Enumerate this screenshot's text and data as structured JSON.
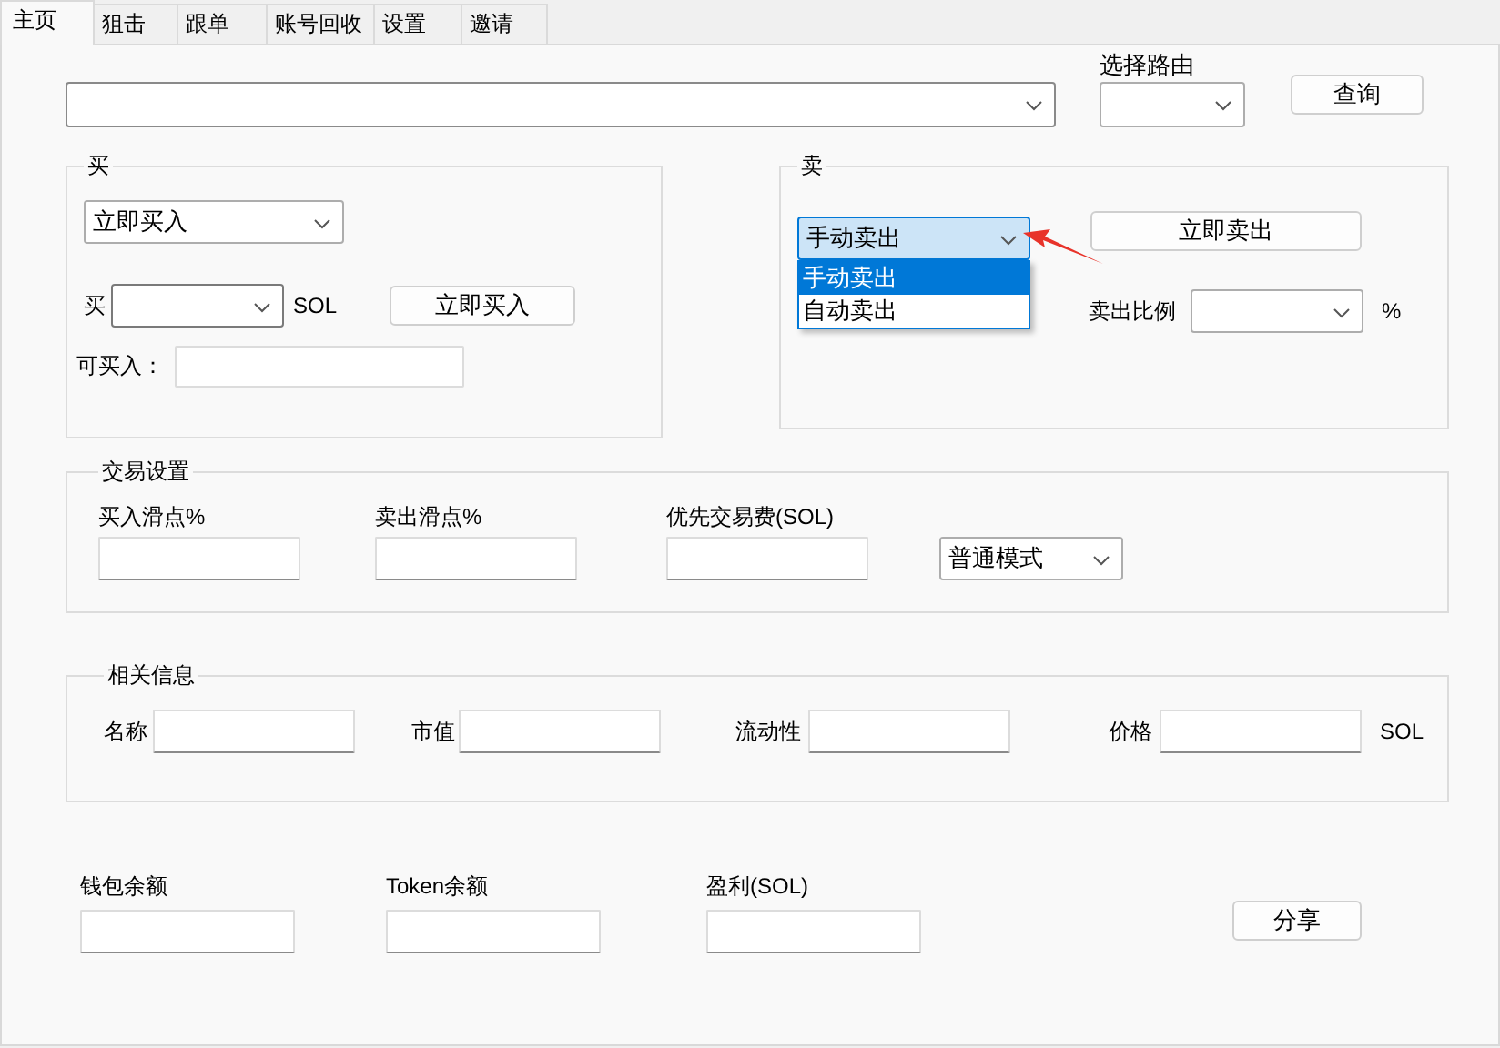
{
  "tabs": [
    {
      "label": "主页",
      "selected": true
    },
    {
      "label": "狙击",
      "selected": false
    },
    {
      "label": "跟单",
      "selected": false
    },
    {
      "label": "账号回收",
      "selected": false
    },
    {
      "label": "设置",
      "selected": false
    },
    {
      "label": "邀请",
      "selected": false
    }
  ],
  "top_bar": {
    "route_label": "选择路由",
    "query_button": "查询"
  },
  "buy": {
    "title": "买",
    "mode": "立即买入",
    "amount_label": "买",
    "unit": "SOL",
    "buy_button": "立即买入",
    "available_label": "可买入："
  },
  "sell": {
    "title": "卖",
    "mode": "手动卖出",
    "expanded": true,
    "options": [
      {
        "label": "手动卖出",
        "selected": true
      },
      {
        "label": "自动卖出",
        "selected": false
      }
    ],
    "sell_button": "立即卖出",
    "ratio_label": "卖出比例",
    "unit": "%"
  },
  "trade_settings": {
    "title": "交易设置",
    "fields": [
      {
        "label": "买入滑点%"
      },
      {
        "label": "卖出滑点%"
      },
      {
        "label": "优先交易费(SOL)"
      }
    ],
    "mode": "普通模式"
  },
  "info": {
    "title": "相关信息",
    "fields": [
      {
        "label": "名称"
      },
      {
        "label": "市值"
      },
      {
        "label": "流动性"
      },
      {
        "label": "价格"
      }
    ],
    "unit": "SOL"
  },
  "balances": [
    {
      "label": "钱包余额"
    },
    {
      "label": "Token余额"
    },
    {
      "label": "盈利(SOL)"
    }
  ],
  "share_button": "分享"
}
